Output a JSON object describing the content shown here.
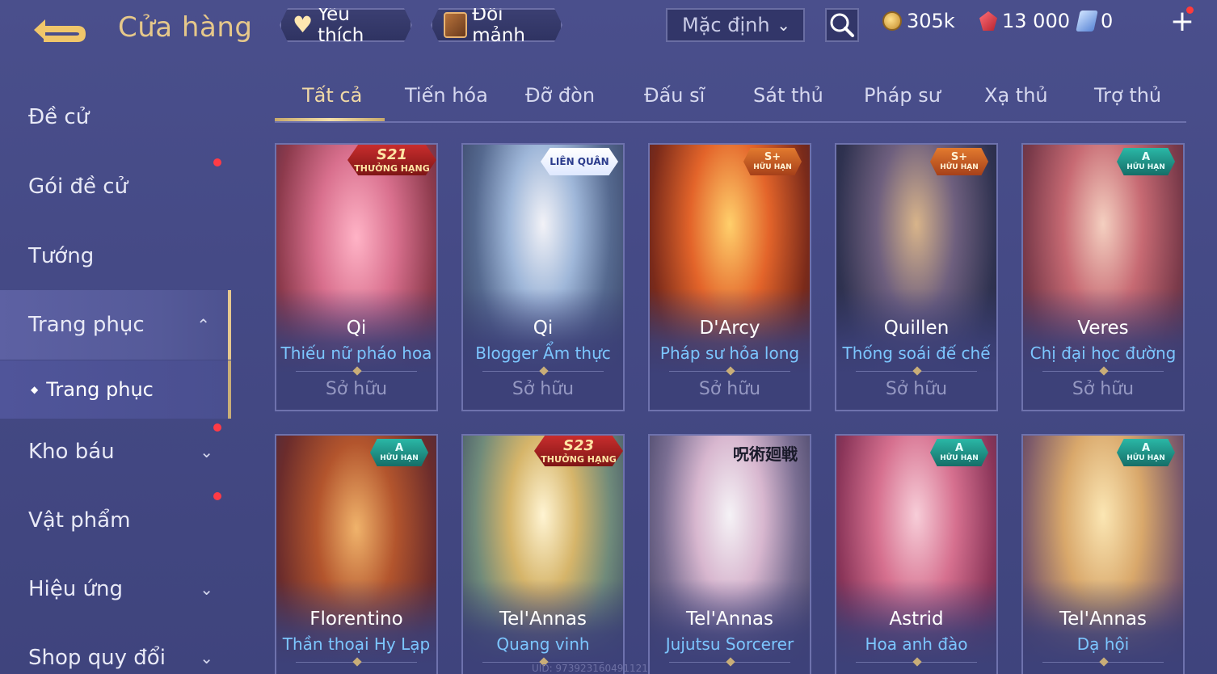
{
  "header": {
    "title": "Cửa hàng",
    "favorites_label": "Yêu thích",
    "shard_exchange_label": "Đổi mảnh",
    "sort_value": "Mặc định",
    "currencies": {
      "gold": "305k",
      "ruby": "13 000",
      "voucher": "0"
    }
  },
  "sidebar": {
    "items": [
      {
        "label": "Đề cử"
      },
      {
        "label": "Gói đề cử"
      },
      {
        "label": "Tướng"
      },
      {
        "label": "Trang phục"
      },
      {
        "label": "Kho báu"
      },
      {
        "label": "Vật phẩm"
      },
      {
        "label": "Hiệu ứng"
      },
      {
        "label": "Shop quy đổi"
      }
    ],
    "sub_item": "Trang phục"
  },
  "tabs": [
    "Tất cả",
    "Tiến hóa",
    "Đỡ đòn",
    "Đấu sĩ",
    "Sát thủ",
    "Pháp sư",
    "Xạ thủ",
    "Trợ thủ"
  ],
  "cards": [
    {
      "hero": "Qi",
      "skin": "Thiếu nữ pháo hoa",
      "status": "Sở hữu",
      "badge_line1": "S21",
      "badge_line2": "THƯỞNG HẠNG"
    },
    {
      "hero": "Qi",
      "skin": "Blogger Ẩm thực",
      "status": "Sở hữu",
      "badge_line1": "LIÊN QUÂN",
      "badge_line2": ""
    },
    {
      "hero": "D'Arcy",
      "skin": "Pháp sư hỏa long",
      "status": "Sở hữu",
      "badge_line1": "S+",
      "badge_line2": "HỮU HẠN"
    },
    {
      "hero": "Quillen",
      "skin": "Thống soái đế chế",
      "status": "Sở hữu",
      "badge_line1": "S+",
      "badge_line2": "HỮU HẠN"
    },
    {
      "hero": "Veres",
      "skin": "Chị đại học đường",
      "status": "Sở hữu",
      "badge_line1": "A",
      "badge_line2": "HỮU HẠN"
    },
    {
      "hero": "Florentino",
      "skin": "Thần thoại Hy Lạp",
      "status": "",
      "badge_line1": "A",
      "badge_line2": "HỮU HẠN"
    },
    {
      "hero": "Tel'Annas",
      "skin": "Quang vinh",
      "status": "",
      "badge_line1": "S23",
      "badge_line2": "THƯỞNG HẠNG"
    },
    {
      "hero": "Tel'Annas",
      "skin": "Jujutsu Sorcerer",
      "status": "",
      "badge_line1": "呪術廻戦",
      "badge_line2": ""
    },
    {
      "hero": "Astrid",
      "skin": "Hoa anh đào",
      "status": "",
      "badge_line1": "A",
      "badge_line2": "HỮU HẠN"
    },
    {
      "hero": "Tel'Annas",
      "skin": "Dạ hội",
      "status": "",
      "badge_line1": "A",
      "badge_line2": "HỮU HẠN"
    }
  ],
  "footer_id": "UID: 973923160491121",
  "colors": {
    "accent": "#e6c88a",
    "skin_name": "#7cc6ff",
    "background": "#454a86"
  },
  "icons": [
    "back-arrow-icon",
    "heart-icon",
    "shard-icon",
    "chevron-down-icon",
    "search-icon",
    "gold-coin-icon",
    "ruby-icon",
    "voucher-icon",
    "plus-icon"
  ]
}
